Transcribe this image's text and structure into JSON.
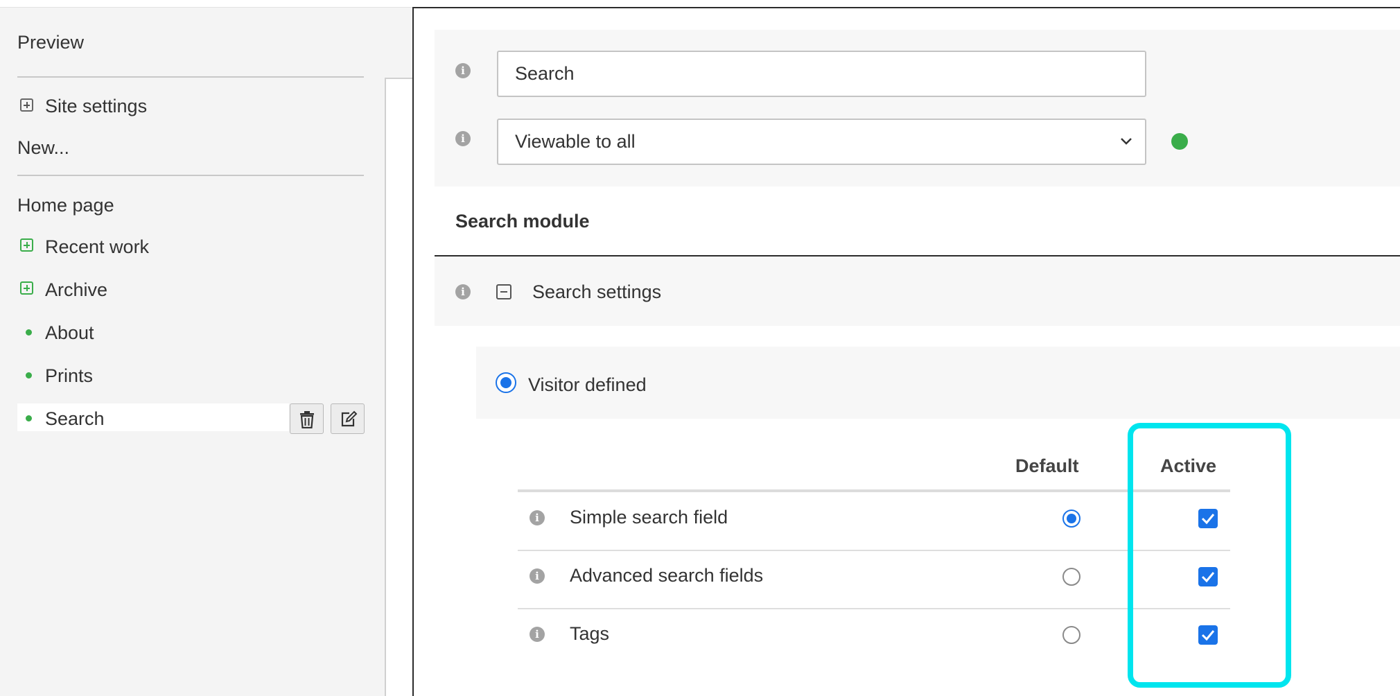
{
  "sidebar": {
    "preview_label": "Preview",
    "site_settings_label": "Site settings",
    "new_label": "New...",
    "pages": [
      {
        "label": "Home page",
        "marker": "none"
      },
      {
        "label": "Recent work",
        "marker": "plus"
      },
      {
        "label": "Archive",
        "marker": "plus"
      },
      {
        "label": "About",
        "marker": "dot"
      },
      {
        "label": "Prints",
        "marker": "dot"
      },
      {
        "label": "Search",
        "marker": "dot",
        "selected": true
      }
    ],
    "actions": {
      "delete_icon": "trash-icon",
      "edit_icon": "edit-icon"
    }
  },
  "page_settings": {
    "title_value": "Search",
    "visibility_value": "Viewable to all",
    "visibility_status_color": "#3aad4a"
  },
  "search_module": {
    "heading": "Search module",
    "settings_label": "Search settings",
    "mode_label": "Visitor defined",
    "mode_selected": true,
    "columns": {
      "default": "Default",
      "active": "Active"
    },
    "rows": [
      {
        "label": "Simple search field",
        "default": true,
        "active": true
      },
      {
        "label": "Advanced search fields",
        "default": false,
        "active": true
      },
      {
        "label": "Tags",
        "default": false,
        "active": true
      }
    ]
  },
  "colors": {
    "accent": "#1a73e8",
    "green": "#3aad4a",
    "highlight": "#00e5ee"
  }
}
